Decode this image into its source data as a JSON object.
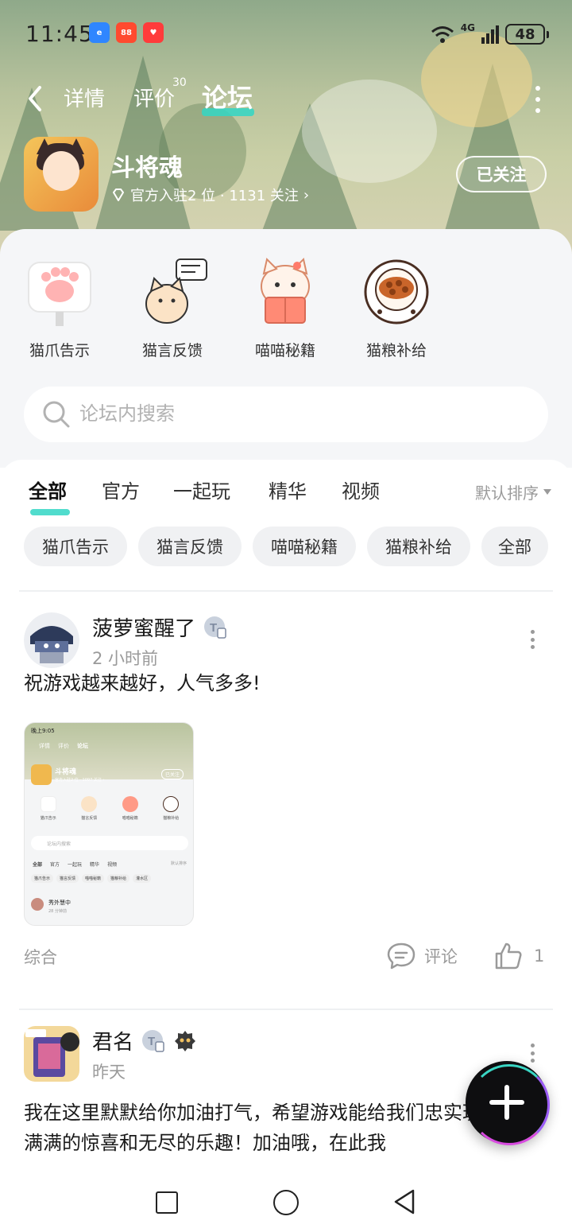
{
  "status": {
    "time": "11:45",
    "network": "4G",
    "battery": "48",
    "app_badges": [
      {
        "icon": "browser-app-icon",
        "color": "#2f86ff"
      },
      {
        "icon": "shop-app-icon",
        "color": "#ff4a2f"
      },
      {
        "icon": "game-app-icon",
        "color": "#ff3b3b"
      }
    ]
  },
  "nav": {
    "tabs": [
      "详情",
      "评价",
      "论坛"
    ],
    "review_count": "30",
    "active_tab": 2
  },
  "game": {
    "name": "斗将魂",
    "meta": "官方入驻2 位 · 1131 关注",
    "meta_chevron": "›",
    "follow_label": "已关注"
  },
  "entries": [
    {
      "label": "猫爪告示",
      "icon": "cat-paw-sign-icon"
    },
    {
      "label": "猫言反馈",
      "icon": "cat-feedback-icon"
    },
    {
      "label": "喵喵秘籍",
      "icon": "cat-guide-book-icon"
    },
    {
      "label": "猫粮补给",
      "icon": "cat-food-bowl-icon"
    }
  ],
  "search": {
    "placeholder": "论坛内搜索"
  },
  "categories": [
    "全部",
    "官方",
    "一起玩",
    "精华",
    "视频"
  ],
  "sort_label": "默认排序",
  "chips": [
    "猫爪告示",
    "猫言反馈",
    "喵喵秘籍",
    "猫粮补给",
    "全部"
  ],
  "posts": [
    {
      "username": "菠萝蜜醒了",
      "time": "2 小时前",
      "text": "祝游戏越来越好，人气多多!",
      "tag": "综合",
      "comment_label": "评论",
      "likes": "1",
      "thumbnail": {
        "time": "晚上9:05",
        "tabs": [
          "详情",
          "评价",
          "论坛"
        ],
        "game_name": "斗将魂",
        "meta": "官方入驻2 位 · 1097 关注 ›",
        "follow": "已关注",
        "entries": [
          "猫爪告示",
          "猫言反馈",
          "喵喵秘籍",
          "猫粮补给"
        ],
        "search": "论坛内搜索",
        "cats": [
          "全部",
          "官方",
          "一起玩",
          "精华",
          "视频"
        ],
        "sort": "默认排序",
        "chips": [
          "猫爪告示",
          "猫言反馈",
          "喵喵秘籍",
          "猫粮补给",
          "灌水区"
        ],
        "user": "秀外慧中",
        "user_time": "28 分钟前"
      }
    },
    {
      "username": "君名",
      "time": "昨天",
      "text": "我在这里默默给你加油打气，希望游戏能给我们忠实玩家带来满满的惊喜和无尽的乐趣！加油哦，在此我"
    }
  ],
  "colors": {
    "accent": "#33d6c4",
    "muted": "#9a9a9a",
    "chip_bg": "#f0f1f3",
    "panel_bg": "#f5f6f8"
  }
}
